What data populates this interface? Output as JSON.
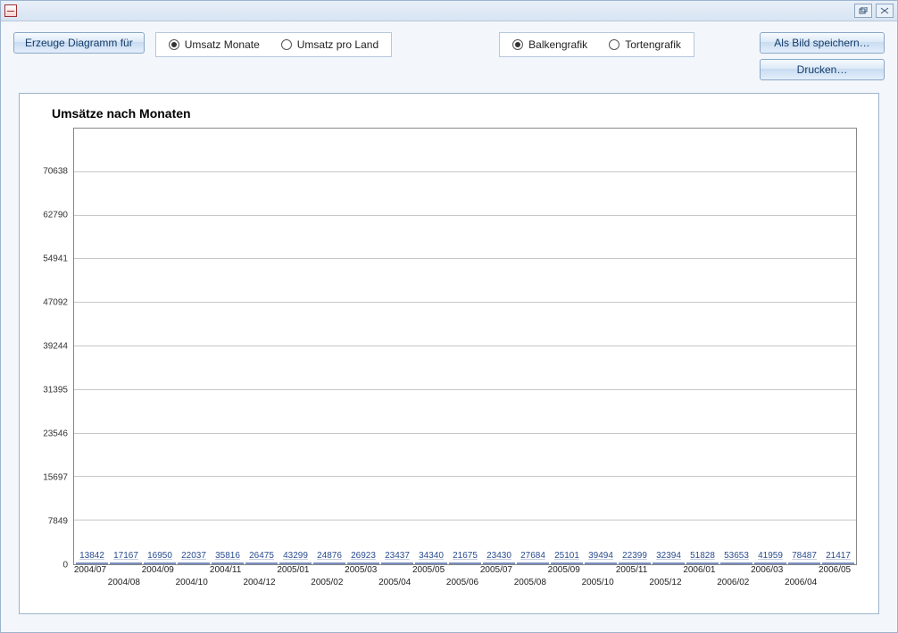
{
  "toolbar": {
    "generate_label": "Erzeuge Diagramm für",
    "radio_group_1": {
      "option_a": "Umsatz Monate",
      "option_b": "Umsatz pro Land",
      "selected": "a"
    },
    "radio_group_2": {
      "option_a": "Balkengrafik",
      "option_b": "Tortengrafik",
      "selected": "a"
    },
    "save_image_label": "Als Bild speichern…",
    "print_label": "Drucken…"
  },
  "chart_data": {
    "type": "bar",
    "title": "Umsätze nach Monaten",
    "xlabel": "",
    "ylabel": "",
    "ylim": [
      0,
      78487
    ],
    "y_ticks": [
      0,
      7849,
      15697,
      23546,
      31395,
      39244,
      47092,
      54941,
      62790,
      70638
    ],
    "categories": [
      "2004/07",
      "2004/08",
      "2004/09",
      "2004/10",
      "2004/11",
      "2004/12",
      "2005/01",
      "2005/02",
      "2005/03",
      "2005/04",
      "2005/05",
      "2005/06",
      "2005/07",
      "2005/08",
      "2005/09",
      "2005/10",
      "2005/11",
      "2005/12",
      "2006/01",
      "2006/02",
      "2006/03",
      "2006/04",
      "2006/05"
    ],
    "values": [
      13842,
      17167,
      16950,
      22037,
      35816,
      26475,
      43299,
      24876,
      26923,
      23437,
      34340,
      21675,
      23430,
      27684,
      25101,
      39494,
      22399,
      32394,
      51828,
      53653,
      41959,
      78487,
      21417
    ]
  }
}
